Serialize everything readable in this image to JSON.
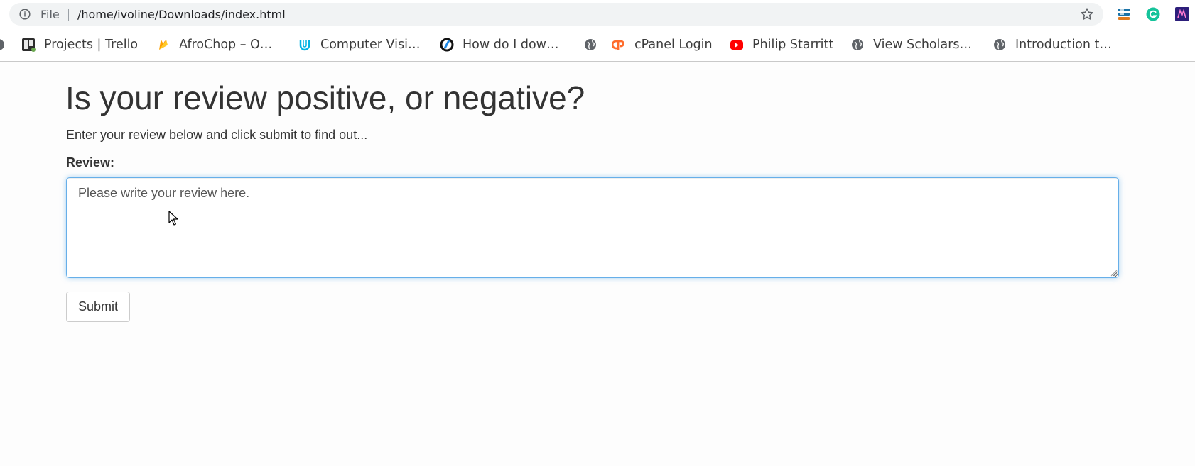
{
  "browser": {
    "address_bar": {
      "scheme_label": "File",
      "url": "/home/ivoline/Downloads/index.html"
    },
    "icons": {
      "info": "info-icon",
      "bookmark_star": "star-icon",
      "extensions": [
        "server-stack-icon",
        "grammarly-icon",
        "purple-extension-icon"
      ]
    },
    "bookmarks": [
      {
        "label": "Projects | Trello",
        "icon": "trello-icon"
      },
      {
        "label": "AfroChop – O…",
        "icon": "firebase-icon"
      },
      {
        "label": "Computer Visi…",
        "icon": "udacity-icon"
      },
      {
        "label": "How do I dow…",
        "icon": "circular-logo-icon"
      },
      {
        "label": "",
        "icon": "globe-icon"
      },
      {
        "label": "cPanel Login",
        "icon": "cpanel-icon"
      },
      {
        "label": "Philip Starritt",
        "icon": "youtube-icon"
      },
      {
        "label": "View Scholars…",
        "icon": "globe-icon"
      },
      {
        "label": "Introduction t…",
        "icon": "globe-icon"
      }
    ]
  },
  "page": {
    "heading": "Is your review positive, or negative?",
    "intro": "Enter your review below and click submit to find out...",
    "form": {
      "review_label": "Review:",
      "review_value": "Please write your review here.",
      "submit_label": "Submit"
    }
  },
  "colors": {
    "focus_border": "#66afe9",
    "text": "#333333",
    "omnibox_bg": "#f1f3f4"
  }
}
